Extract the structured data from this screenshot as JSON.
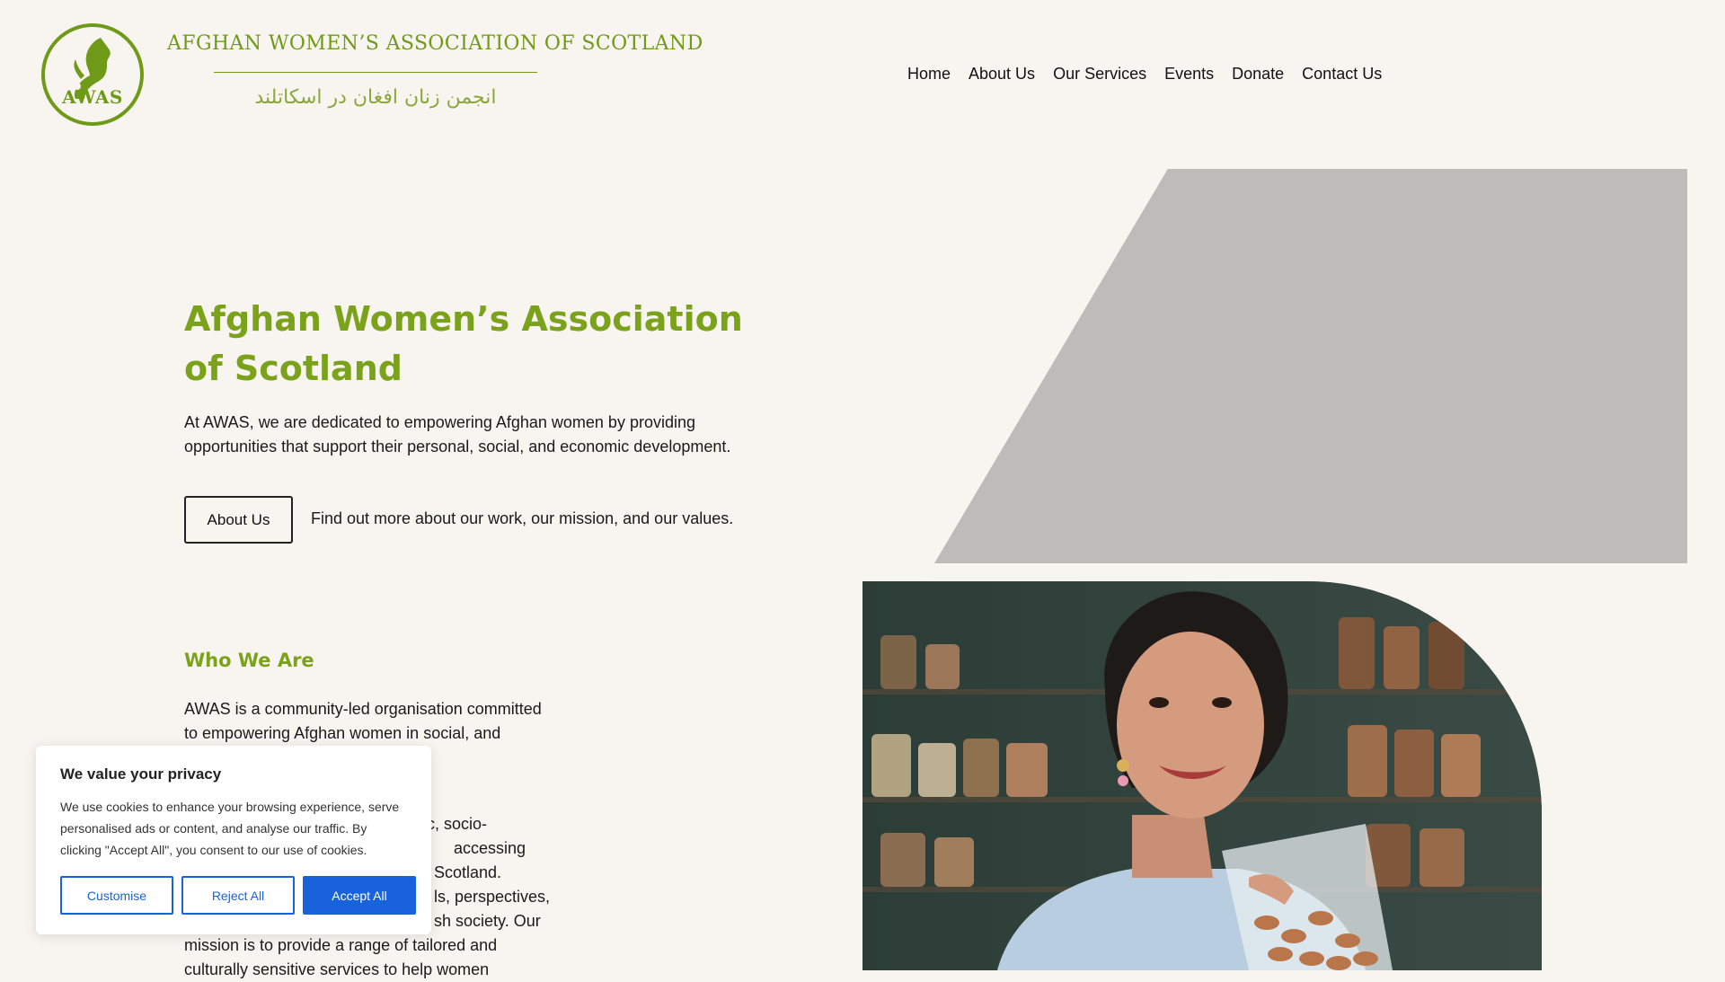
{
  "header": {
    "logo_text": "AWAS",
    "brand_english": "AFGHAN WOMEN’S ASSOCIATION OF SCOTLAND",
    "brand_farsi": "انجمن زنان افغان در اسکاتلند",
    "nav": [
      {
        "label": "Home"
      },
      {
        "label": "About Us"
      },
      {
        "label": "Our Services"
      },
      {
        "label": "Events"
      },
      {
        "label": "Donate"
      },
      {
        "label": "Contact Us"
      }
    ]
  },
  "hero": {
    "title": "Afghan Women’s Association of Scotland",
    "description": "At AWAS, we are dedicated to empowering Afghan women by providing opportunities that support their personal, social, and economic development.",
    "button_label": "About Us",
    "button_caption": "Find out more about our work, our mission, and our values."
  },
  "who_we_are": {
    "title": "Who We Are",
    "paragraph1": "AWAS is a community-led organisation committed to empowering Afghan women in",
    "paragraph1_tail": "social, and",
    "paragraph2_lines": [
      "c, socio-",
      "accessing",
      "Scotland.",
      "ls, perspectives,",
      "sh society. Our",
      "mission is to provide a range of tailored and",
      "culturally sensitive services to help women"
    ]
  },
  "cookie_banner": {
    "title": "We value your privacy",
    "text": "We use cookies to enhance your browsing experience, serve personalised ads or content, and analyse our traffic. By clicking \"Accept All\", you consent to our use of cookies.",
    "customise_label": "Customise",
    "reject_label": "Reject All",
    "accept_label": "Accept All"
  },
  "colors": {
    "brand_green": "#7ba21b",
    "background": "#f8f5f0",
    "grey_shape": "#bdbcb8",
    "cookie_blue": "#1863dc"
  }
}
